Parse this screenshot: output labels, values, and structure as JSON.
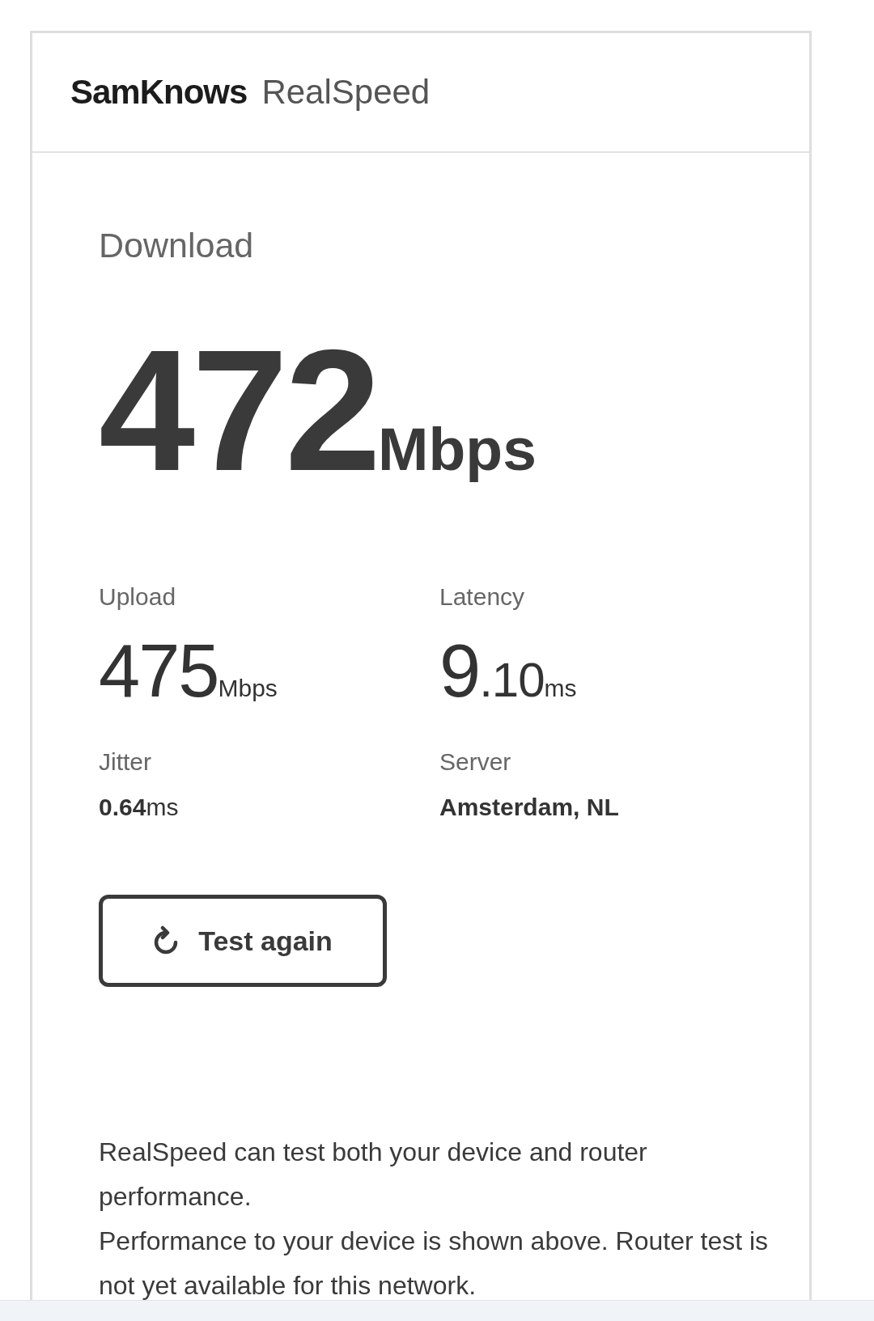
{
  "header": {
    "brand": "SamKnows",
    "product": "RealSpeed"
  },
  "download": {
    "label": "Download",
    "value": "472",
    "unit": "Mbps"
  },
  "metrics": [
    {
      "kind": "large",
      "label": "Upload",
      "value": "475",
      "unit": "Mbps"
    },
    {
      "kind": "large",
      "label": "Latency",
      "value": "9",
      "fraction": ".10",
      "unit": "ms"
    },
    {
      "kind": "small",
      "label": "Jitter",
      "value": "0.64",
      "unit": "ms"
    },
    {
      "kind": "small",
      "label": "Server",
      "value": "Amsterdam, NL"
    }
  ],
  "button": {
    "label": "Test again"
  },
  "notes": [
    "RealSpeed can test both your device and router performance.",
    "Performance to your device is shown above. Router test is not yet available for this network."
  ]
}
